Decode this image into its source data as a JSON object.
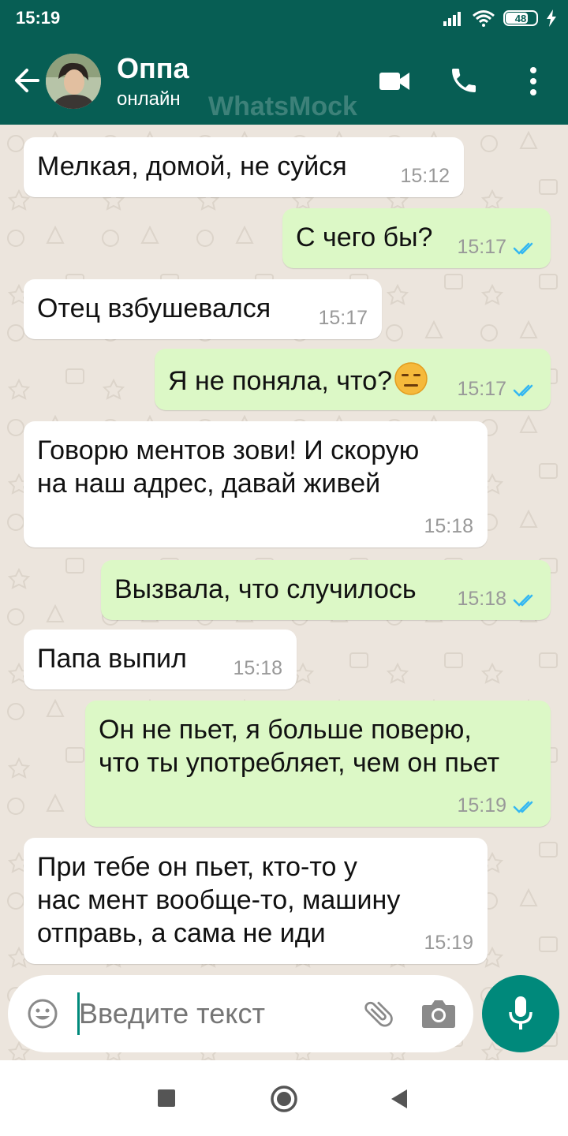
{
  "status_bar": {
    "time": "15:19",
    "battery": "48"
  },
  "header": {
    "contact_name": "Оппа",
    "contact_status": "онлайн",
    "watermark": "WhatsMock"
  },
  "messages": [
    {
      "direction": "in",
      "text": "Мелкая, домой, не суйся",
      "time": "15:12"
    },
    {
      "direction": "out",
      "text": "С чего бы?",
      "time": "15:17",
      "status": "read"
    },
    {
      "direction": "in",
      "text": "Отец взбушевался",
      "time": "15:17"
    },
    {
      "direction": "out",
      "text": "Я не поняла, что?",
      "emoji": "expressionless-face",
      "time": "15:17",
      "status": "read"
    },
    {
      "direction": "in",
      "text": "Говорю ментов зови! И скорую\nна наш адрес, давай живей",
      "time": "15:18"
    },
    {
      "direction": "out",
      "text": "Вызвала, что случилось",
      "time": "15:18",
      "status": "read"
    },
    {
      "direction": "in",
      "text": "Папа выпил",
      "time": "15:18"
    },
    {
      "direction": "out",
      "text": "Он не пьет, я больше поверю,\nчто ты употребляет, чем он пьет",
      "time": "15:19",
      "status": "read"
    },
    {
      "direction": "in",
      "text": "При тебе он пьет, кто-то у\nнас мент вообще-то, машину\nотправь, а сама не иди",
      "time": "15:19"
    }
  ],
  "composer": {
    "placeholder": "Введите текст"
  },
  "colors": {
    "header": "#075e54",
    "accent": "#00897b",
    "outgoing_bubble": "#dcf8c6",
    "incoming_bubble": "#ffffff",
    "read_ticks": "#34b7f1"
  },
  "icons": {
    "header": [
      "back-arrow-icon",
      "video-call-icon",
      "phone-icon",
      "more-options-icon"
    ],
    "composer": [
      "emoji-icon",
      "attach-icon",
      "camera-icon",
      "mic-icon"
    ],
    "nav": [
      "recent-apps-icon",
      "home-icon",
      "back-icon"
    ]
  }
}
